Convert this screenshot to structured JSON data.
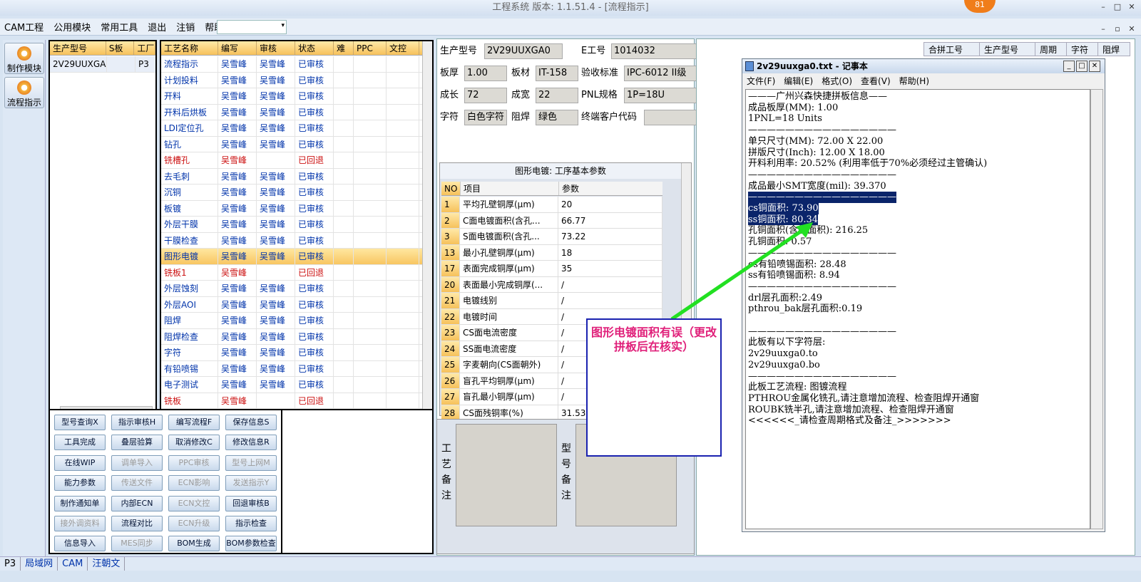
{
  "window": {
    "title": "工程系统   版本: 1.1.51.4 - [流程指示]",
    "badge": "81"
  },
  "menubar": {
    "items": [
      "CAM工程",
      "公用模块",
      "常用工具",
      "退出",
      "注销",
      "帮助"
    ],
    "help_arrow": "▾"
  },
  "left_toolbar": {
    "items": [
      "制作模块",
      "流程指示"
    ]
  },
  "prod_grid": {
    "headers": [
      "生产型号",
      "S板",
      "工厂"
    ],
    "rows": [
      [
        "2V29UUXGA0",
        "",
        "P3"
      ]
    ]
  },
  "process_grid": {
    "headers": [
      "工艺名称",
      "编写",
      "审核",
      "状态",
      "难",
      "PPC",
      "文控"
    ],
    "rows": [
      {
        "name": "流程指示",
        "writer": "吴雪峰",
        "reviewer": "吴雪峰",
        "status": "已审核",
        "red": false
      },
      {
        "name": "计划投料",
        "writer": "吴雪峰",
        "reviewer": "吴雪峰",
        "status": "已审核",
        "red": false
      },
      {
        "name": "开料",
        "writer": "吴雪峰",
        "reviewer": "吴雪峰",
        "status": "已审核",
        "red": false
      },
      {
        "name": "开料后烘板",
        "writer": "吴雪峰",
        "reviewer": "吴雪峰",
        "status": "已审核",
        "red": false
      },
      {
        "name": "LDI定位孔",
        "writer": "吴雪峰",
        "reviewer": "吴雪峰",
        "status": "已审核",
        "red": false
      },
      {
        "name": "钻孔",
        "writer": "吴雪峰",
        "reviewer": "吴雪峰",
        "status": "已审核",
        "red": false
      },
      {
        "name": "铣槽孔",
        "writer": "吴雪峰",
        "reviewer": "",
        "status": "已回退",
        "red": true
      },
      {
        "name": "去毛刺",
        "writer": "吴雪峰",
        "reviewer": "吴雪峰",
        "status": "已审核",
        "red": false
      },
      {
        "name": "沉铜",
        "writer": "吴雪峰",
        "reviewer": "吴雪峰",
        "status": "已审核",
        "red": false
      },
      {
        "name": "板镀",
        "writer": "吴雪峰",
        "reviewer": "吴雪峰",
        "status": "已审核",
        "red": false
      },
      {
        "name": "外层干膜",
        "writer": "吴雪峰",
        "reviewer": "吴雪峰",
        "status": "已审核",
        "red": false
      },
      {
        "name": "干膜检查",
        "writer": "吴雪峰",
        "reviewer": "吴雪峰",
        "status": "已审核",
        "red": false
      },
      {
        "name": "图形电镀",
        "writer": "吴雪峰",
        "reviewer": "吴雪峰",
        "status": "已审核",
        "red": false,
        "selected": true
      },
      {
        "name": "铣板1",
        "writer": "吴雪峰",
        "reviewer": "",
        "status": "已回退",
        "red": true
      },
      {
        "name": "外层蚀刻",
        "writer": "吴雪峰",
        "reviewer": "吴雪峰",
        "status": "已审核",
        "red": false
      },
      {
        "name": "外层AOI",
        "writer": "吴雪峰",
        "reviewer": "吴雪峰",
        "status": "已审核",
        "red": false
      },
      {
        "name": "阻焊",
        "writer": "吴雪峰",
        "reviewer": "吴雪峰",
        "status": "已审核",
        "red": false
      },
      {
        "name": "阻焊检查",
        "writer": "吴雪峰",
        "reviewer": "吴雪峰",
        "status": "已审核",
        "red": false
      },
      {
        "name": "字符",
        "writer": "吴雪峰",
        "reviewer": "吴雪峰",
        "status": "已审核",
        "red": false
      },
      {
        "name": "有铅喷锡",
        "writer": "吴雪峰",
        "reviewer": "吴雪峰",
        "status": "已审核",
        "red": false
      },
      {
        "name": "电子测试",
        "writer": "吴雪峰",
        "reviewer": "吴雪峰",
        "status": "已审核",
        "red": false
      },
      {
        "name": "铣板",
        "writer": "吴雪峰",
        "reviewer": "",
        "status": "已回退",
        "red": true
      }
    ]
  },
  "buttons": [
    {
      "label": "型号查询X",
      "dis": false
    },
    {
      "label": "指示审核H",
      "dis": false
    },
    {
      "label": "编写流程F",
      "dis": false
    },
    {
      "label": "保存信息S",
      "dis": false
    },
    {
      "label": "工具完成",
      "dis": false
    },
    {
      "label": "叠层验算",
      "dis": false
    },
    {
      "label": "取消修改C",
      "dis": false
    },
    {
      "label": "修改信息R",
      "dis": false
    },
    {
      "label": "在线WIP",
      "dis": false
    },
    {
      "label": "调单导入",
      "dis": true
    },
    {
      "label": "PPC审核",
      "dis": true
    },
    {
      "label": "型号上网M",
      "dis": true
    },
    {
      "label": "能力参数",
      "dis": false
    },
    {
      "label": "传送文件",
      "dis": true
    },
    {
      "label": "ECN影响",
      "dis": true
    },
    {
      "label": "发送指示Y",
      "dis": true
    },
    {
      "label": "制作通知单",
      "dis": false
    },
    {
      "label": "内部ECN",
      "dis": false
    },
    {
      "label": "ECN文控",
      "dis": true
    },
    {
      "label": "回退审核B",
      "dis": false
    },
    {
      "label": "接外调资料",
      "dis": true
    },
    {
      "label": "流程对比",
      "dis": false
    },
    {
      "label": "ECN升级",
      "dis": true
    },
    {
      "label": "指示检查",
      "dis": false
    },
    {
      "label": "信息导入",
      "dis": false
    },
    {
      "label": "MES同步",
      "dis": true
    },
    {
      "label": "BOM生成",
      "dis": false
    },
    {
      "label": "BOM参数检查",
      "dis": false
    }
  ],
  "info": {
    "prod_model_label": "生产型号",
    "prod_model": "2V29UUXGA0",
    "e_no_label": "E工号",
    "e_no": "1014032",
    "thickness_label": "板厚",
    "thickness": "1.00",
    "material_label": "板材",
    "material": "IT-158",
    "std_label": "验收标准",
    "std": "IPC-6012 II级",
    "len_label": "成长",
    "len": "72",
    "wid_label": "成宽",
    "wid": "22",
    "pnl_label": "PNL规格",
    "pnl": "1P=18U",
    "char_label": "字符",
    "char": "白色字符",
    "mask_label": "阻焊",
    "mask": "绿色",
    "cust_label": "终端客户代码",
    "cust": ""
  },
  "param_panel": {
    "title": "图形电镀: 工序基本参数",
    "headers": [
      "NO",
      "项目",
      "参数"
    ],
    "rows": [
      [
        "1",
        "平均孔壁铜厚(μm)",
        "20"
      ],
      [
        "2",
        "C面电镀面积(含孔...",
        "66.77"
      ],
      [
        "3",
        "S面电镀面积(含孔...",
        "73.22"
      ],
      [
        "13",
        "最小孔壁铜厚(μm)",
        "18"
      ],
      [
        "17",
        "表面完成铜厚(μm)",
        "35"
      ],
      [
        "20",
        "表面最小完成铜厚(...",
        "/"
      ],
      [
        "21",
        "电镀线别",
        "/"
      ],
      [
        "22",
        "电镀时间",
        "/"
      ],
      [
        "23",
        "CS面电流密度",
        "/"
      ],
      [
        "24",
        "SS面电流密度",
        "/"
      ],
      [
        "25",
        "字麦朝向(CS面朝外)",
        "/"
      ],
      [
        "26",
        "盲孔平均铜厚(μm)",
        "/"
      ],
      [
        "27",
        "盲孔最小铜厚(μm)",
        "/"
      ],
      [
        "28",
        "CS面残铜率(%)",
        "31.53"
      ]
    ]
  },
  "notes": {
    "process_label": "工艺备注",
    "model_label": "型号备注"
  },
  "right_grid": {
    "headers": [
      "合拼工号",
      "生产型号",
      "周期",
      "字符",
      "阻焊"
    ]
  },
  "notepad": {
    "title": "2v29uuxga0.txt - 记事本",
    "menu": [
      "文件(F)",
      "编辑(E)",
      "格式(O)",
      "查看(V)",
      "帮助(H)"
    ],
    "lines": [
      "———广州兴森快捷拼板信息——",
      "成品板厚(MM): 1.00",
      "1PNL=18 Units",
      "————————————————",
      "单只尺寸(MM): 72.00 X 22.00",
      "拼版尺寸(Inch): 12.00 X 18.00",
      "开料利用率: 20.52% (利用率低于70%必须经过主管确认)",
      "————————————————",
      "成品最小SMT宽度(mil): 39.370",
      "————————————————",
      "cs铜面积: 73.90",
      "ss铜面积: 80.34",
      "孔铜面积(含板面积): 216.25",
      "孔铜面积: 0.57",
      "————————————————",
      "cs有铅喷锡面积: 28.48",
      "ss有铅喷锡面积: 8.94",
      "————————————————",
      "drl层孔面积:2.49",
      "pthrou_bak层孔面积:0.19",
      "",
      "————————————————",
      "此板有以下字符层:",
      "2v29uuxga0.to",
      "2v29uuxga0.bo",
      "————————————————",
      "此板工艺流程: 图镀流程",
      "PTHROU金属化铣孔,请注意增加流程、检查阻焊开通窗",
      "ROUBK铣半孔,请注意增加流程、检查阻焊开通窗",
      "<<<<<<_请检查周期格式及备注_>>>>>>>"
    ]
  },
  "callout": {
    "text": "图形电镀面积有误（更改拼板后在核实）",
    "color": "#e0207a"
  },
  "statusbar": {
    "items": [
      "P3",
      "局域网",
      "CAM",
      "汪朝文"
    ]
  }
}
